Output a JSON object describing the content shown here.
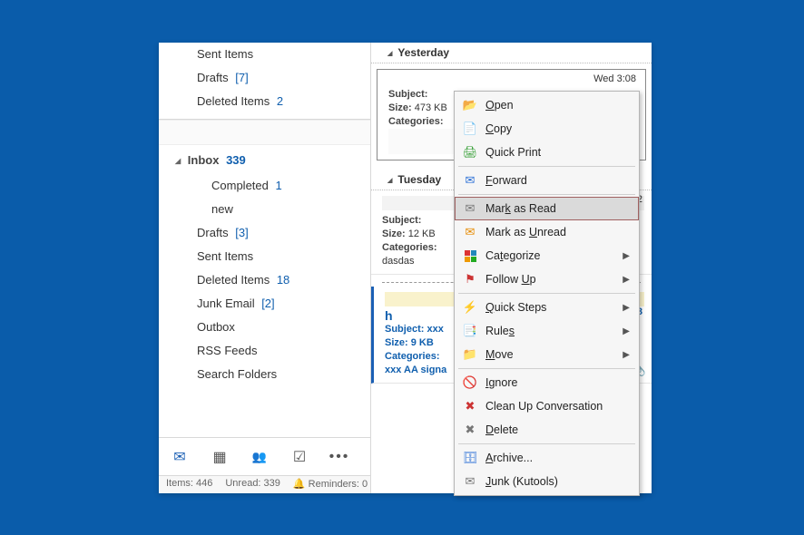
{
  "folders_top": [
    {
      "name": "Sent Items",
      "count": ""
    },
    {
      "name": "Drafts",
      "count": "[7]"
    },
    {
      "name": "Deleted Items",
      "count": "2"
    }
  ],
  "account": {
    "name": "Inbox",
    "count": "339"
  },
  "subfolders": [
    {
      "name": "Completed",
      "count": "1"
    },
    {
      "name": "new",
      "count": ""
    }
  ],
  "folders_bottom": [
    {
      "name": "Drafts",
      "count": "[3]"
    },
    {
      "name": "Sent Items",
      "count": ""
    },
    {
      "name": "Deleted Items",
      "count": "18"
    },
    {
      "name": "Junk Email",
      "count": "[2]"
    },
    {
      "name": "Outbox",
      "count": ""
    },
    {
      "name": "RSS Feeds",
      "count": ""
    },
    {
      "name": "Search Folders",
      "count": ""
    }
  ],
  "status": {
    "items": "Items: 446",
    "unread": "Unread: 339",
    "reminders": "Reminders: 0"
  },
  "groups": {
    "yesterday": "Yesterday",
    "tuesday": "Tuesday"
  },
  "msg1": {
    "time": "Wed 3:08",
    "subject_label": "Subject:",
    "size_label": "Size:",
    "size": "473 KB",
    "cat_label": "Categories:"
  },
  "msg2": {
    "time": ":12",
    "subject_label": "Subject:",
    "size_label": "Size:",
    "size": "12 KB",
    "cat_label": "Categories:",
    "preview": "dasdas"
  },
  "msg3": {
    "sender_initial": "h",
    "time": "08 ",
    "subject_label": "Subject:",
    "subject": "xxx",
    "size_label": "Size:",
    "size": "9 KB",
    "cat_label": "Categories:",
    "preview": "xxx  AA signa"
  },
  "context_menu": [
    {
      "icon": "open",
      "label": "Open",
      "accel": "O"
    },
    {
      "icon": "copy",
      "label": "Copy",
      "accel": "C"
    },
    {
      "icon": "print",
      "label": "Quick Print"
    },
    {
      "sep": true
    },
    {
      "icon": "forward",
      "label": "Forward",
      "accel": "F"
    },
    {
      "sep": true
    },
    {
      "icon": "markread",
      "label": "Mark as Read",
      "accel": "k",
      "selected": true
    },
    {
      "icon": "markunread",
      "label": "Mark as Unread",
      "accel": "U"
    },
    {
      "icon": "categorize",
      "label": "Categorize",
      "accel": "t",
      "submenu": true
    },
    {
      "icon": "followup",
      "label": "Follow Up",
      "accel": "U",
      "submenu": true
    },
    {
      "sep": true
    },
    {
      "icon": "quicksteps",
      "label": "Quick Steps",
      "accel": "Q",
      "submenu": true
    },
    {
      "icon": "rules",
      "label": "Rules",
      "accel": "s",
      "submenu": true
    },
    {
      "icon": "move",
      "label": "Move",
      "accel": "M",
      "submenu": true
    },
    {
      "sep": true
    },
    {
      "icon": "ignore",
      "label": "Ignore",
      "accel": "I"
    },
    {
      "icon": "cleanup",
      "label": "Clean Up Conversation"
    },
    {
      "icon": "delete",
      "label": "Delete",
      "accel": "D"
    },
    {
      "sep": true
    },
    {
      "icon": "archive",
      "label": "Archive...",
      "accel": "A"
    },
    {
      "icon": "junk",
      "label": "Junk (Kutools)",
      "accel": "J"
    }
  ],
  "icon_glyphs": {
    "open": "📂",
    "copy": "📄",
    "print": "🖨",
    "forward": "✉",
    "markread": "✉",
    "markunread": "✉",
    "categorize": "cat",
    "followup": "⚑",
    "quicksteps": "⚡",
    "rules": "📑",
    "move": "📁",
    "ignore": "🚫",
    "cleanup": "✖",
    "delete": "✖",
    "archive": "🗄",
    "junk": "✉"
  }
}
